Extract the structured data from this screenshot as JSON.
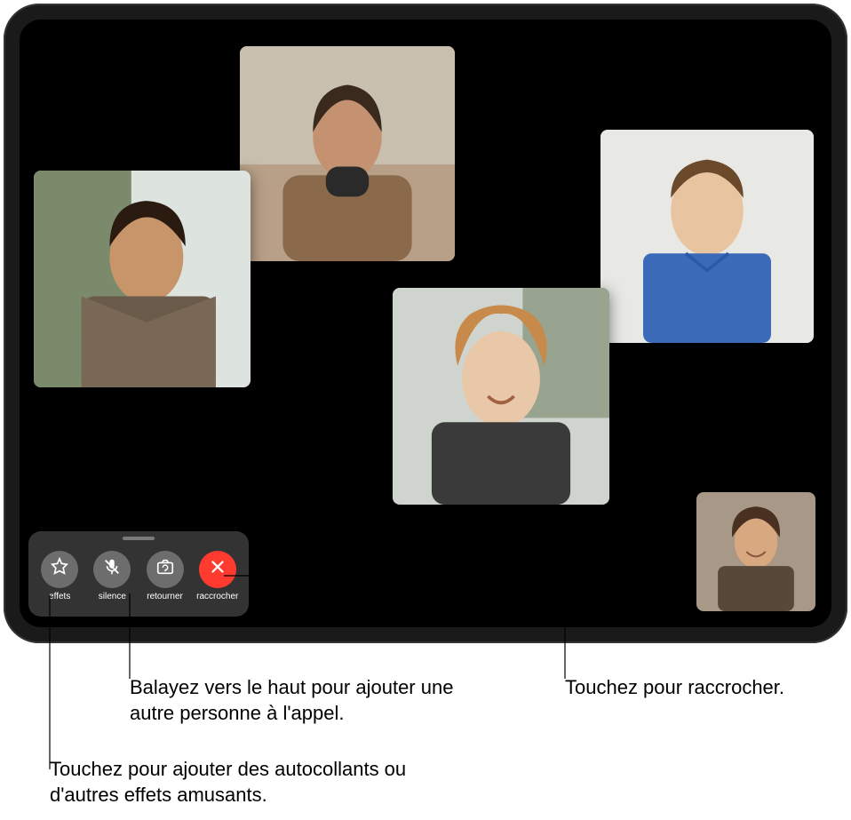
{
  "controls": {
    "effects": "effets",
    "mute": "silence",
    "flip": "retourner",
    "end": "raccrocher"
  },
  "callouts": {
    "swipe_up": "Balayez vers le haut pour ajouter une autre personne à l'appel.",
    "end_call": "Touchez pour raccrocher.",
    "stickers": "Touchez pour ajouter des autocollants ou d'autres effets amusants."
  },
  "participants": [
    {
      "id": "top-center"
    },
    {
      "id": "left"
    },
    {
      "id": "right"
    },
    {
      "id": "center"
    }
  ]
}
